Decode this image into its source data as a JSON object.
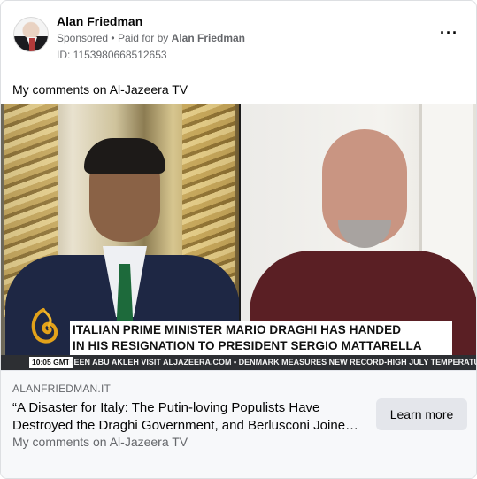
{
  "post": {
    "author_name": "Alan Friedman",
    "sponsored_label": "Sponsored",
    "separator": "•",
    "paid_for_prefix": "Paid for by",
    "paid_for_name": "Alan Friedman",
    "ad_id": "ID: 1153980668512653",
    "more_icon": "more-options-icon",
    "caption": "My comments on Al-Jazeera TV"
  },
  "media": {
    "lower_third_line1": "ITALIAN PRIME MINISTER MARIO DRAGHI HAS HANDED",
    "lower_third_line2": "IN HIS RESIGNATION TO PRESIDENT SERGIO MATTARELLA",
    "time": "10:05 GMT",
    "ticker": "REEN ABU AKLEH VISIT ALJAZEERA.COM  •  DENMARK MEASURES NEW RECORD-HIGH JULY TEMPERATURE",
    "logo_icon": "al-jazeera-logo"
  },
  "link": {
    "domain": "ALANFRIEDMAN.IT",
    "headline_line1": "“A Disaster for Italy: The Putin-loving Populists Have",
    "headline_line2": "Destroyed the Draghi Government, and Berlusconi Joine…",
    "description": "My comments on Al-Jazeera TV",
    "cta_label": "Learn more"
  },
  "colors": {
    "secondary_text": "#65676b",
    "button_bg": "#e4e6eb",
    "footer_bg": "#f7f8fa"
  }
}
